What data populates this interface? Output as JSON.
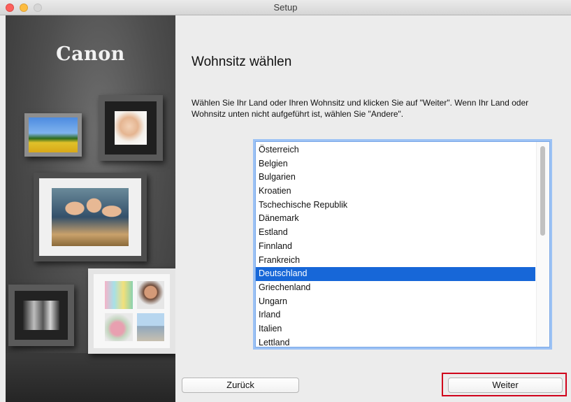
{
  "window": {
    "title": "Setup"
  },
  "sidebar": {
    "logo": "Canon"
  },
  "main": {
    "heading": "Wohnsitz wählen",
    "description": "Wählen Sie Ihr Land oder Ihren Wohnsitz und klicken Sie auf \"Weiter\". Wenn Ihr Land oder Wohnsitz unten nicht aufgeführt ist, wählen Sie \"Andere\".",
    "countries": [
      "Österreich",
      "Belgien",
      "Bulgarien",
      "Kroatien",
      "Tschechische Republik",
      "Dänemark",
      "Estland",
      "Finnland",
      "Frankreich",
      "Deutschland",
      "Griechenland",
      "Ungarn",
      "Irland",
      "Italien",
      "Lettland"
    ],
    "selected_country": "Deutschland"
  },
  "buttons": {
    "back": "Zurück",
    "next": "Weiter"
  },
  "colors": {
    "selection": "#1767d8",
    "highlight_box": "#d0021b",
    "focus_ring": "#9cc2f5"
  }
}
